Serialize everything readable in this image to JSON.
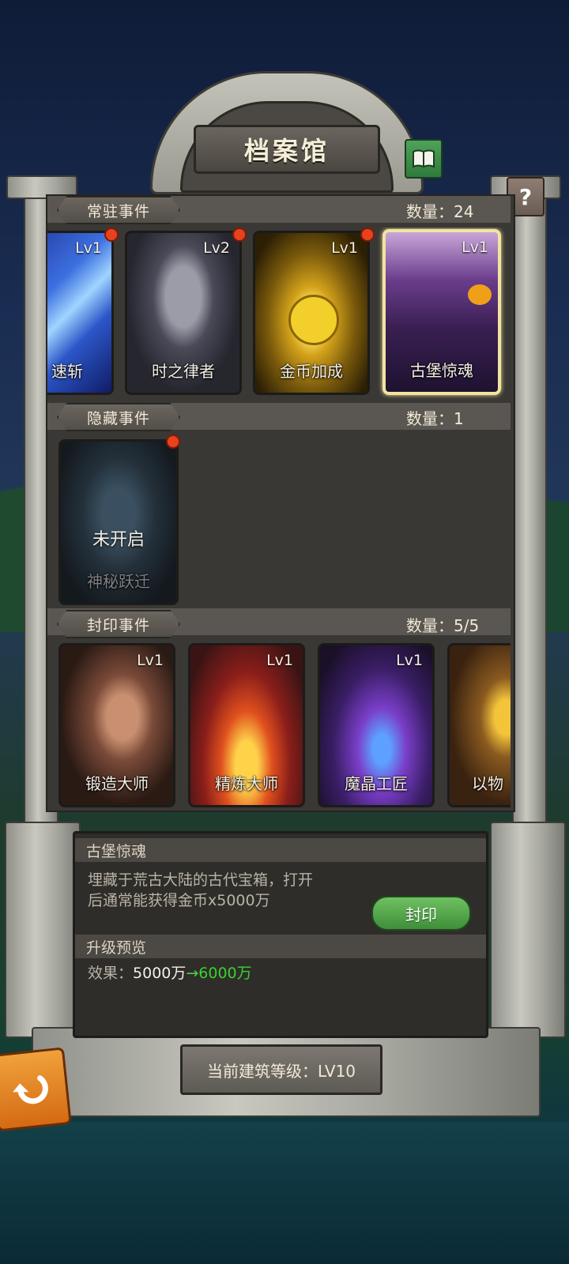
{
  "title": "档案馆",
  "sections": {
    "resident": {
      "label": "常驻事件",
      "count_label": "数量：24"
    },
    "hidden": {
      "label": "隐藏事件",
      "count_label": "数量：1"
    },
    "sealed": {
      "label": "封印事件",
      "count_label": "数量：5/5"
    }
  },
  "resident_cards": [
    {
      "name": "速斩",
      "level": "Lv1"
    },
    {
      "name": "时之律者",
      "level": "Lv2"
    },
    {
      "name": "金币加成",
      "level": "Lv1"
    },
    {
      "name": "古堡惊魂",
      "level": "Lv1"
    }
  ],
  "hidden_cards": [
    {
      "status": "未开启",
      "name": "神秘跃迁"
    }
  ],
  "sealed_cards": [
    {
      "name": "锻造大师",
      "level": "Lv1"
    },
    {
      "name": "精炼大师",
      "level": "Lv1"
    },
    {
      "name": "魔晶工匠",
      "level": "Lv1"
    },
    {
      "name": "以物",
      "level": ""
    }
  ],
  "detail": {
    "title": "古堡惊魂",
    "description_line1": "埋藏于荒古大陆的古代宝箱，打开",
    "description_line2": "后通常能获得金币x5000万",
    "seal_button": "封印",
    "upgrade_header": "升级预览",
    "effect_label": "效果：",
    "effect_from": "5000万",
    "effect_arrow": "→",
    "effect_to": "6000万"
  },
  "building_level": "当前建筑等级：LV10",
  "help_symbol": "?",
  "colors": {
    "effect_to": "#39d22f",
    "arrow": "#4fd04a",
    "notify_dot": "#e8421c",
    "selected_border": "#f2e4a0"
  }
}
